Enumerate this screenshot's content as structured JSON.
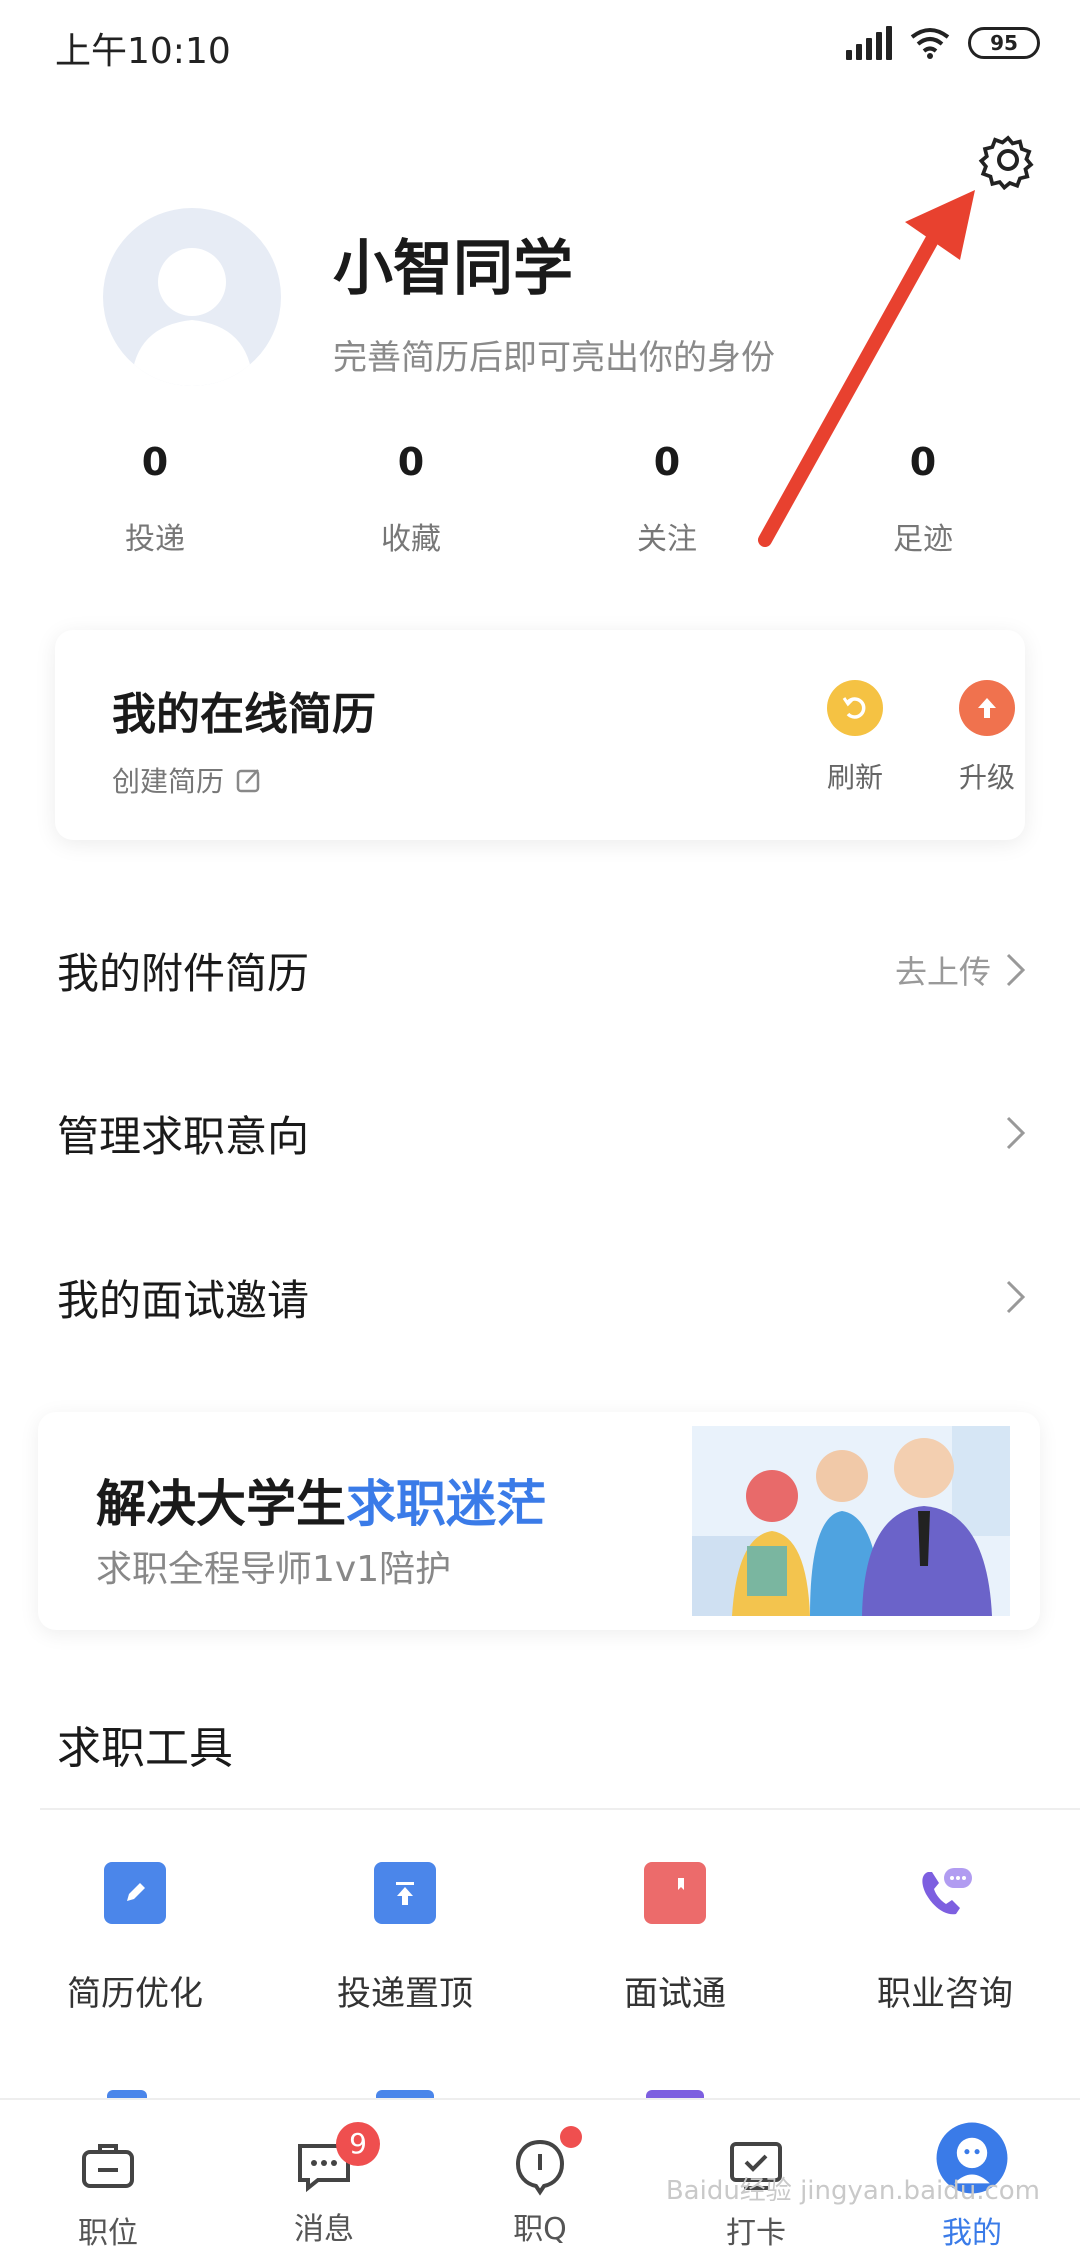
{
  "status_bar": {
    "time": "上午10:10",
    "battery": "95"
  },
  "profile": {
    "name": "小智同学",
    "subtitle": "完善简历后即可亮出你的身份",
    "stats": [
      {
        "value": "0",
        "label": "投递"
      },
      {
        "value": "0",
        "label": "收藏"
      },
      {
        "value": "0",
        "label": "关注"
      },
      {
        "value": "0",
        "label": "足迹"
      }
    ]
  },
  "resume_card": {
    "title": "我的在线简历",
    "create_label": "创建简历",
    "refresh_label": "刷新",
    "upgrade_label": "升级"
  },
  "menu": {
    "attachment": {
      "label": "我的附件简历",
      "action": "去上传"
    },
    "intent": {
      "label": "管理求职意向"
    },
    "interview": {
      "label": "我的面试邀请"
    }
  },
  "banner": {
    "title_prefix": "解决大学生",
    "title_highlight": "求职迷茫",
    "subtitle": "求职全程导师1v1陪护"
  },
  "tools": {
    "title": "求职工具",
    "items": [
      {
        "label": "简历优化",
        "icon": "edit-icon"
      },
      {
        "label": "投递置顶",
        "icon": "pin-top-icon"
      },
      {
        "label": "面试通",
        "icon": "book-icon"
      },
      {
        "label": "职业咨询",
        "icon": "phone-chat-icon"
      }
    ]
  },
  "bottom_nav": {
    "items": [
      {
        "label": "职位",
        "icon": "briefcase-icon"
      },
      {
        "label": "消息",
        "icon": "message-icon",
        "badge": "9"
      },
      {
        "label": "职Q",
        "icon": "q-bubble-icon"
      },
      {
        "label": "打卡",
        "icon": "checkin-icon"
      },
      {
        "label": "我的",
        "icon": "mine-icon"
      }
    ],
    "active_index": 4
  },
  "watermark": "Baidu经验 jingyan.baidu.com",
  "colors": {
    "accent": "#3a7be8",
    "badge": "#ef4f4f",
    "arrow": "#e8412f"
  }
}
